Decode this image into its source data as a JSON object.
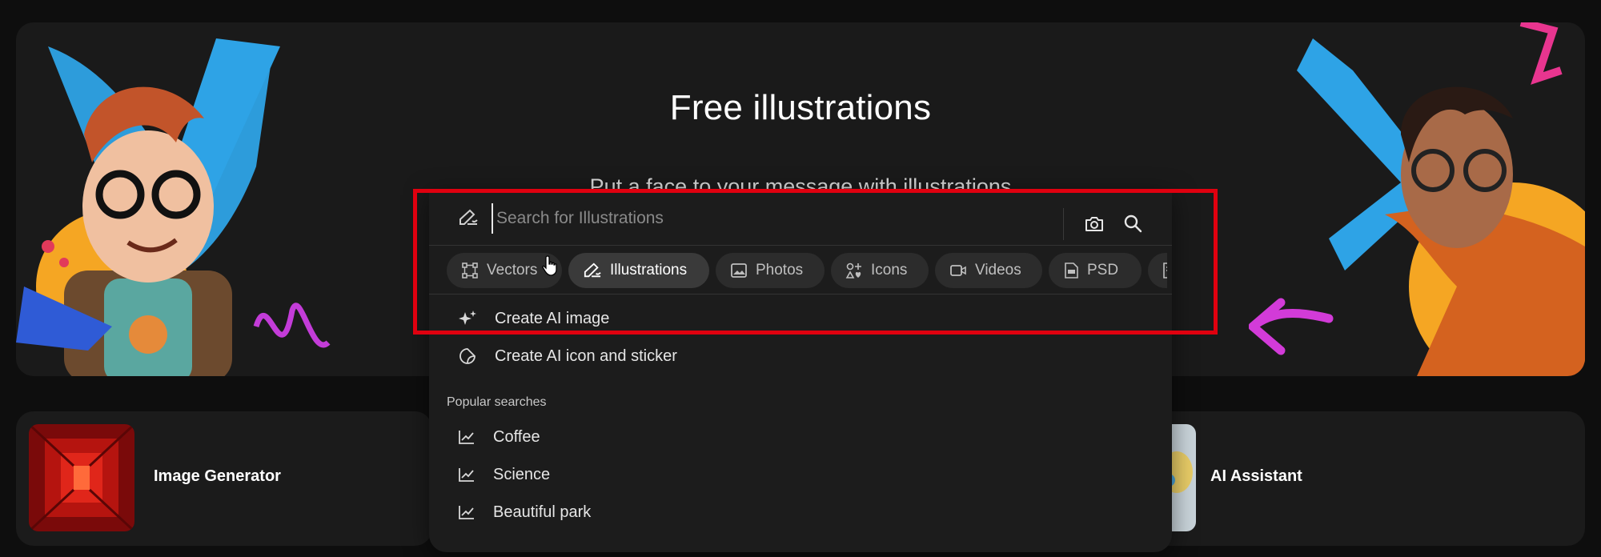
{
  "hero": {
    "title": "Free illustrations",
    "subtitle": "Put a face to your message with illustrations"
  },
  "search": {
    "placeholder": "Search for Illustrations",
    "left_icon": "pen-illustration-icon",
    "camera_icon": "camera-icon",
    "search_icon": "search-icon"
  },
  "chips": [
    {
      "label": "Vectors",
      "icon": "vector-icon",
      "active": false
    },
    {
      "label": "Illustrations",
      "icon": "pen-illustration-icon",
      "active": true
    },
    {
      "label": "Photos",
      "icon": "image-icon",
      "active": false
    },
    {
      "label": "Icons",
      "icon": "icons-grid-icon",
      "active": false
    },
    {
      "label": "Videos",
      "icon": "video-icon",
      "active": false
    },
    {
      "label": "PSD",
      "icon": "psd-file-icon",
      "active": false
    }
  ],
  "ai_actions": [
    {
      "label": "Create AI image",
      "icon": "sparkle-icon"
    },
    {
      "label": "Create AI icon and sticker",
      "icon": "sticker-icon"
    }
  ],
  "popular": {
    "heading": "Popular searches",
    "items": [
      {
        "label": "Coffee",
        "icon": "trend-icon"
      },
      {
        "label": "Science",
        "icon": "trend-icon"
      },
      {
        "label": "Beautiful park",
        "icon": "trend-icon"
      }
    ]
  },
  "cards": {
    "left": {
      "label": "Image Generator"
    },
    "right": {
      "label": "AI Assistant"
    }
  },
  "colors": {
    "background": "#0e0e0e",
    "panel": "#1c1c1c",
    "chip": "#2c2c2c",
    "chip_active": "#3a3a3a",
    "highlight": "#e0000f"
  }
}
